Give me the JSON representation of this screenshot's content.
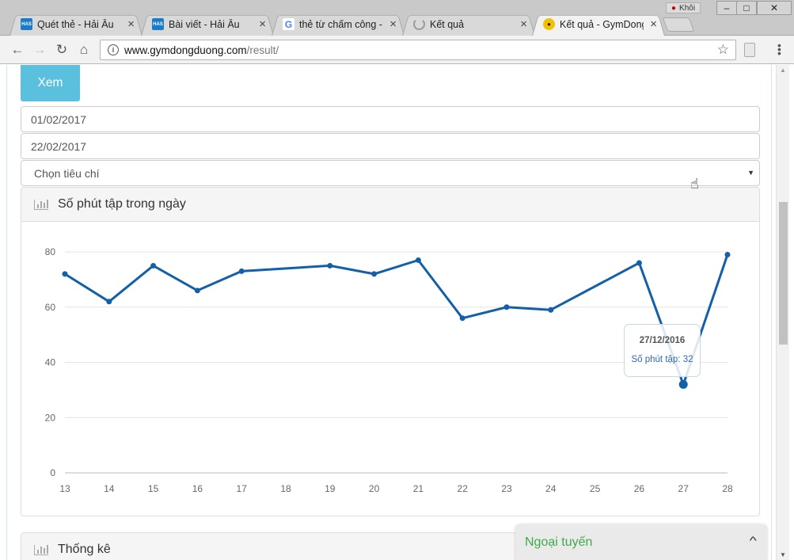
{
  "browser": {
    "tabs": [
      {
        "title": "Quét thẻ - Hải Âu",
        "favicon": "has-icon",
        "active": false
      },
      {
        "title": "Bài viết - Hải Âu",
        "favicon": "has-icon",
        "active": false
      },
      {
        "title": "thẻ từ chấm công -",
        "favicon": "google-icon",
        "active": false
      },
      {
        "title": "Kết quả",
        "favicon": "loading-icon",
        "active": false
      },
      {
        "title": "Kết quả - GymDong",
        "favicon": "gym-icon",
        "active": true
      }
    ],
    "favicon_has_text": "HAS",
    "favicon_google_text": "G",
    "profile_name": "Khôi",
    "url_host": "www.gymdongduong.com",
    "url_path": "/result/",
    "window_controls": {
      "minimize": "–",
      "maximize": "□",
      "close": "✕"
    }
  },
  "form": {
    "view_button": "Xem",
    "start_date": "01/02/2017",
    "end_date": "22/02/2017",
    "criteria_placeholder": "Chọn tiêu chí"
  },
  "panels": {
    "chart_title": "Số phút tập trong ngày",
    "stats_title": "Thống kê"
  },
  "tooltip": {
    "date": "27/12/2016",
    "label": "Số phút tập: 32"
  },
  "chat": {
    "status": "Ngoại tuyến"
  },
  "colors": {
    "line": "#1360a8",
    "button": "#5bc0de",
    "chat_text": "#3eab48"
  },
  "chart_data": {
    "type": "line",
    "title": "Số phút tập trong ngày",
    "xlabel": "",
    "ylabel": "",
    "x": [
      13,
      14,
      15,
      16,
      17,
      18,
      19,
      20,
      21,
      22,
      23,
      24,
      25,
      26,
      27,
      28
    ],
    "points": [
      [
        13,
        72
      ],
      [
        14,
        62
      ],
      [
        15,
        75
      ],
      [
        16,
        66
      ],
      [
        17,
        73
      ],
      [
        19,
        75
      ],
      [
        20,
        72
      ],
      [
        21,
        77
      ],
      [
        22,
        56
      ],
      [
        23,
        60
      ],
      [
        24,
        59
      ],
      [
        26,
        76
      ],
      [
        27,
        32
      ],
      [
        28,
        79
      ]
    ],
    "ylim": [
      0,
      80
    ],
    "yticks": [
      0,
      20,
      40,
      60,
      80
    ],
    "grid": true,
    "highlight": {
      "x": 27,
      "y": 32
    }
  }
}
